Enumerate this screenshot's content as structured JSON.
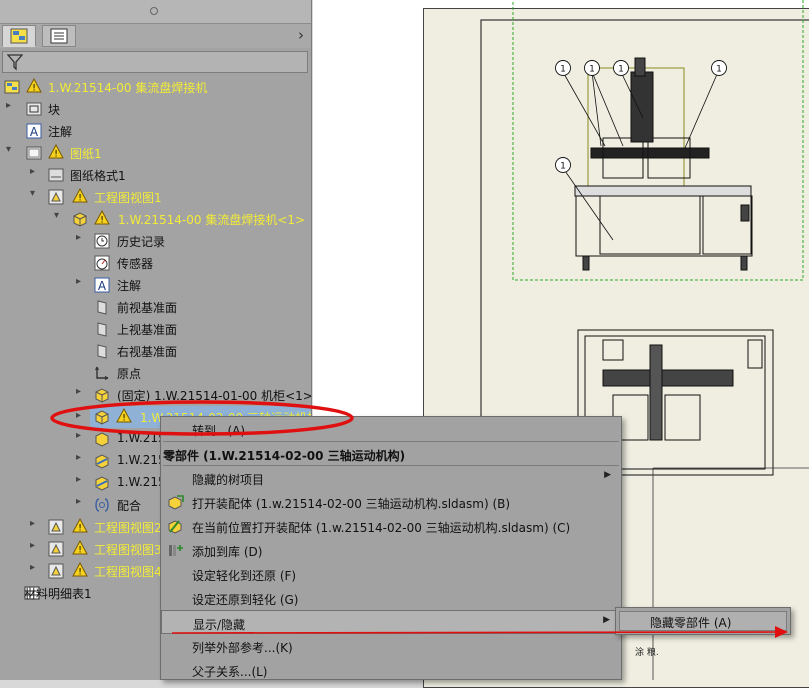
{
  "tree": {
    "root": {
      "label": "1.W.21514-00 集流盘焊接机"
    },
    "blocks": {
      "label": "块"
    },
    "notes": {
      "label": "注解"
    },
    "sheet": {
      "label": "图纸1"
    },
    "sheet_format": {
      "label": "图纸格式1"
    },
    "drawing_view1": {
      "label": "工程图视图1"
    },
    "assembly": {
      "label": "1.W.21514-00 集流盘焊接机<1>"
    },
    "history": {
      "label": "历史记录"
    },
    "sensors": {
      "label": "传感器"
    },
    "notes2": {
      "label": "注解"
    },
    "front_plane": {
      "label": "前视基准面"
    },
    "top_plane": {
      "label": "上视基准面"
    },
    "right_plane": {
      "label": "右视基准面"
    },
    "origin": {
      "label": "原点"
    },
    "cabinet": {
      "label": "(固定) 1.W.21514-01-00 机柜<1>"
    },
    "three_axis": {
      "label": "1.W.21514-02-00 三轴运动机构"
    },
    "sub_a": {
      "label": "1.W.215"
    },
    "sub_b": {
      "label": "1.W.215"
    },
    "sub_c": {
      "label": "1.W.215"
    },
    "mates": {
      "label": "配合"
    },
    "drawing_view2": {
      "label": "工程图视图2"
    },
    "drawing_view3": {
      "label": "工程图视图3"
    },
    "drawing_view4": {
      "label": "工程图视图4"
    },
    "bom": {
      "label": "材料明细表1"
    }
  },
  "context_menu": {
    "goto": "转到...(A)",
    "header": "零部件 (1.W.21514-02-00 三轴运动机构)",
    "hidden_tree_items": "隐藏的树项目",
    "open_assembly": "打开装配体 (1.w.21514-02-00 三轴运动机构.sldasm) (B)",
    "open_in_place": "在当前位置打开装配体 (1.w.21514-02-00 三轴运动机构.sldasm) (C)",
    "add_to_library": "添加到库 (D)",
    "set_lightweight_restore": "设定轻化到还原 (F)",
    "set_restore_lightweight": "设定还原到轻化 (G)",
    "show_hide": "显示/隐藏",
    "list_external_refs": "列举外部参考...(K)",
    "parent_child": "父子关系...(L)"
  },
  "submenu": {
    "hide_component": "隐藏零部件 (A)"
  },
  "drawing": {
    "balloons": [
      "1",
      "1",
      "1",
      "1",
      "1"
    ],
    "note_text": "涂 粮."
  },
  "colors": {
    "panel_bg": "#a3a3a3",
    "warning_yellow": "#f3ec37",
    "annotation_red": "#e01010",
    "sheet_bg": "#efeee1",
    "view_border_green": "#2caa2c"
  }
}
